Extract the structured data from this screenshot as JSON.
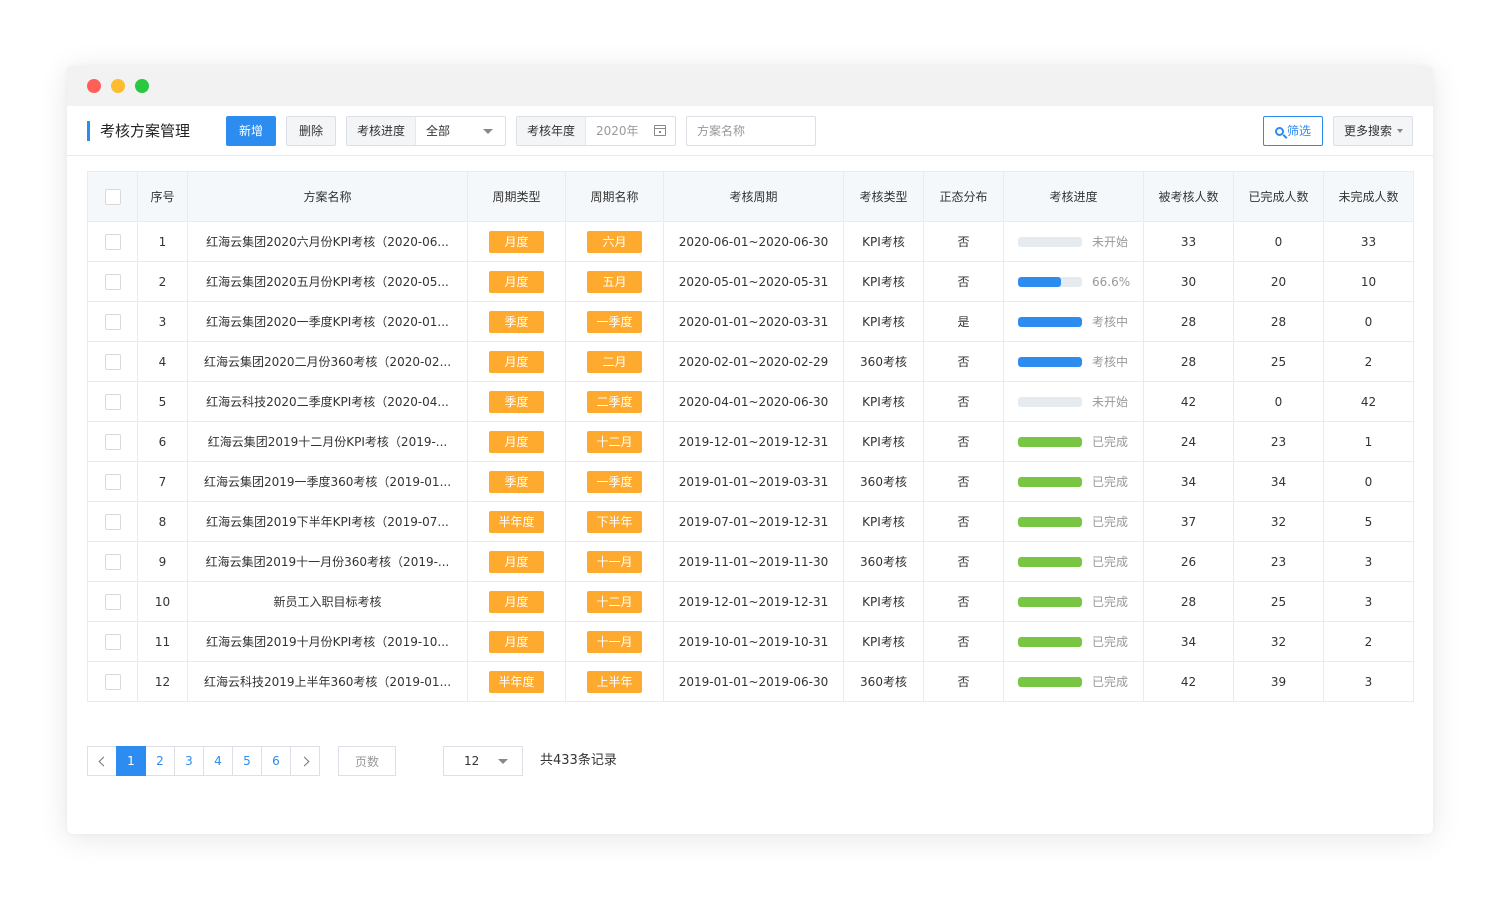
{
  "header": {
    "title": "考核方案管理",
    "add_label": "新增",
    "delete_label": "删除",
    "progress_filter": {
      "label": "考核进度",
      "value": "全部"
    },
    "year_filter": {
      "label": "考核年度",
      "placeholder": "2020年"
    },
    "name_placeholder": "方案名称",
    "filter_label": "筛选",
    "more_label": "更多搜索"
  },
  "table": {
    "columns": [
      "序号",
      "方案名称",
      "周期类型",
      "周期名称",
      "考核周期",
      "考核类型",
      "正态分布",
      "考核进度",
      "被考核人数",
      "已完成人数",
      "未完成人数"
    ],
    "rows": [
      {
        "no": "1",
        "name": "红海云集团2020六月份KPI考核（2020-06...",
        "cycle_type": "月度",
        "cycle_name": "六月",
        "period": "2020-06-01~2020-06-30",
        "type": "KPI考核",
        "normal": "否",
        "progress": 0,
        "progress_color": "#2d8cf0",
        "progress_text": "未开始",
        "assessed": "33",
        "completed": "0",
        "incomplete": "33"
      },
      {
        "no": "2",
        "name": "红海云集团2020五月份KPI考核（2020-05...",
        "cycle_type": "月度",
        "cycle_name": "五月",
        "period": "2020-05-01~2020-05-31",
        "type": "KPI考核",
        "normal": "否",
        "progress": 0.666,
        "progress_color": "#2d8cf0",
        "progress_text": "66.6%",
        "assessed": "30",
        "completed": "20",
        "incomplete": "10"
      },
      {
        "no": "3",
        "name": "红海云集团2020一季度KPI考核（2020-01...",
        "cycle_type": "季度",
        "cycle_name": "一季度",
        "period": "2020-01-01~2020-03-31",
        "type": "KPI考核",
        "normal": "是",
        "progress": 1,
        "progress_color": "#2d8cf0",
        "progress_text": "考核中",
        "assessed": "28",
        "completed": "28",
        "incomplete": "0"
      },
      {
        "no": "4",
        "name": "红海云集团2020二月份360考核（2020-02...",
        "cycle_type": "月度",
        "cycle_name": "二月",
        "period": "2020-02-01~2020-02-29",
        "type": "360考核",
        "normal": "否",
        "progress": 1,
        "progress_color": "#2d8cf0",
        "progress_text": "考核中",
        "assessed": "28",
        "completed": "25",
        "incomplete": "2"
      },
      {
        "no": "5",
        "name": "红海云科技2020二季度KPI考核（2020-04...",
        "cycle_type": "季度",
        "cycle_name": "二季度",
        "period": "2020-04-01~2020-06-30",
        "type": "KPI考核",
        "normal": "否",
        "progress": 0,
        "progress_color": "#2d8cf0",
        "progress_text": "未开始",
        "assessed": "42",
        "completed": "0",
        "incomplete": "42"
      },
      {
        "no": "6",
        "name": "红海云集团2019十二月份KPI考核（2019-...",
        "cycle_type": "月度",
        "cycle_name": "十二月",
        "period": "2019-12-01~2019-12-31",
        "type": "KPI考核",
        "normal": "否",
        "progress": 1,
        "progress_color": "#79c544",
        "progress_text": "已完成",
        "assessed": "24",
        "completed": "23",
        "incomplete": "1"
      },
      {
        "no": "7",
        "name": "红海云集团2019一季度360考核（2019-01...",
        "cycle_type": "季度",
        "cycle_name": "一季度",
        "period": "2019-01-01~2019-03-31",
        "type": "360考核",
        "normal": "否",
        "progress": 1,
        "progress_color": "#79c544",
        "progress_text": "已完成",
        "assessed": "34",
        "completed": "34",
        "incomplete": "0"
      },
      {
        "no": "8",
        "name": "红海云集团2019下半年KPI考核（2019-07...",
        "cycle_type": "半年度",
        "cycle_name": "下半年",
        "period": "2019-07-01~2019-12-31",
        "type": "KPI考核",
        "normal": "否",
        "progress": 1,
        "progress_color": "#79c544",
        "progress_text": "已完成",
        "assessed": "37",
        "completed": "32",
        "incomplete": "5"
      },
      {
        "no": "9",
        "name": "红海云集团2019十一月份360考核（2019-...",
        "cycle_type": "月度",
        "cycle_name": "十一月",
        "period": "2019-11-01~2019-11-30",
        "type": "360考核",
        "normal": "否",
        "progress": 1,
        "progress_color": "#79c544",
        "progress_text": "已完成",
        "assessed": "26",
        "completed": "23",
        "incomplete": "3"
      },
      {
        "no": "10",
        "name": "新员工入职目标考核",
        "cycle_type": "月度",
        "cycle_name": "十二月",
        "period": "2019-12-01~2019-12-31",
        "type": "KPI考核",
        "normal": "否",
        "progress": 1,
        "progress_color": "#79c544",
        "progress_text": "已完成",
        "assessed": "28",
        "completed": "25",
        "incomplete": "3"
      },
      {
        "no": "11",
        "name": "红海云集团2019十月份KPI考核（2019-10...",
        "cycle_type": "月度",
        "cycle_name": "十一月",
        "period": "2019-10-01~2019-10-31",
        "type": "KPI考核",
        "normal": "否",
        "progress": 1,
        "progress_color": "#79c544",
        "progress_text": "已完成",
        "assessed": "34",
        "completed": "32",
        "incomplete": "2"
      },
      {
        "no": "12",
        "name": "红海云科技2019上半年360考核（2019-01...",
        "cycle_type": "半年度",
        "cycle_name": "上半年",
        "period": "2019-01-01~2019-06-30",
        "type": "360考核",
        "normal": "否",
        "progress": 1,
        "progress_color": "#79c544",
        "progress_text": "已完成",
        "assessed": "42",
        "completed": "39",
        "incomplete": "3"
      }
    ]
  },
  "pagination": {
    "pages": [
      "1",
      "2",
      "3",
      "4",
      "5",
      "6"
    ],
    "current": "1",
    "page_input_placeholder": "页数",
    "page_size": "12",
    "total_text": "共433条记录"
  },
  "colors": {
    "accent": "#2d8cf0",
    "tag": "#fdaa2f",
    "done": "#79c544",
    "track": "#e6ebf0"
  }
}
